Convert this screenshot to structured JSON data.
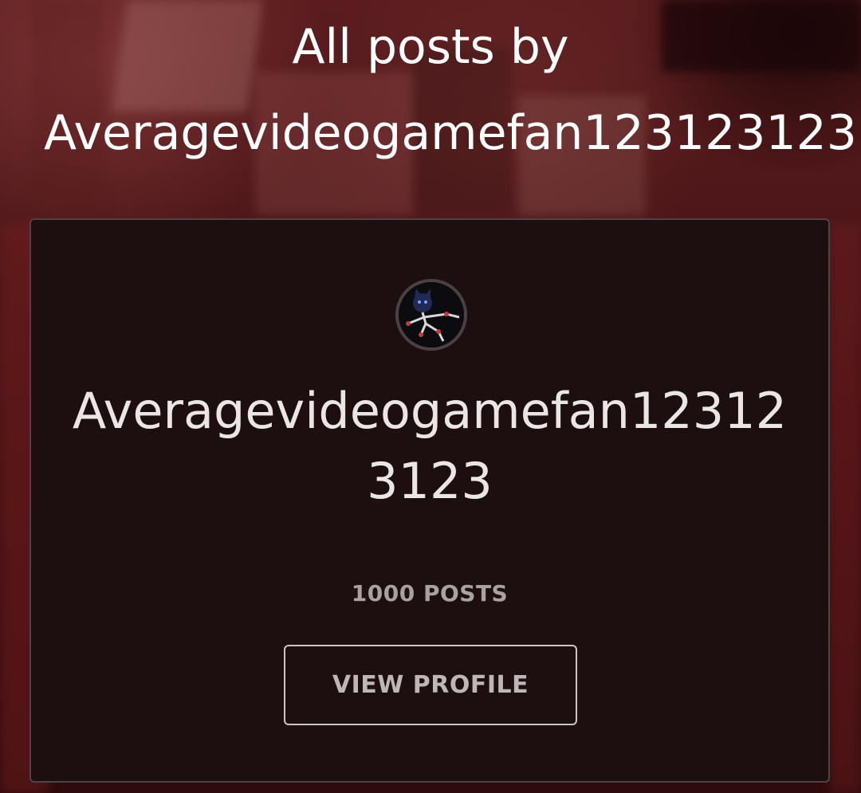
{
  "header": {
    "title_line1": "All posts by",
    "title_line2": "Averagevideogamefan123123123"
  },
  "profile_card": {
    "username": "Averagevideogamefan123123123",
    "post_count": "1000 POSTS",
    "view_profile_label": "VIEW PROFILE"
  },
  "colors": {
    "card_background": "#1d0e10",
    "card_border": "#4e4446",
    "text_primary": "#ffffff",
    "text_muted": "#a9a2a3"
  }
}
